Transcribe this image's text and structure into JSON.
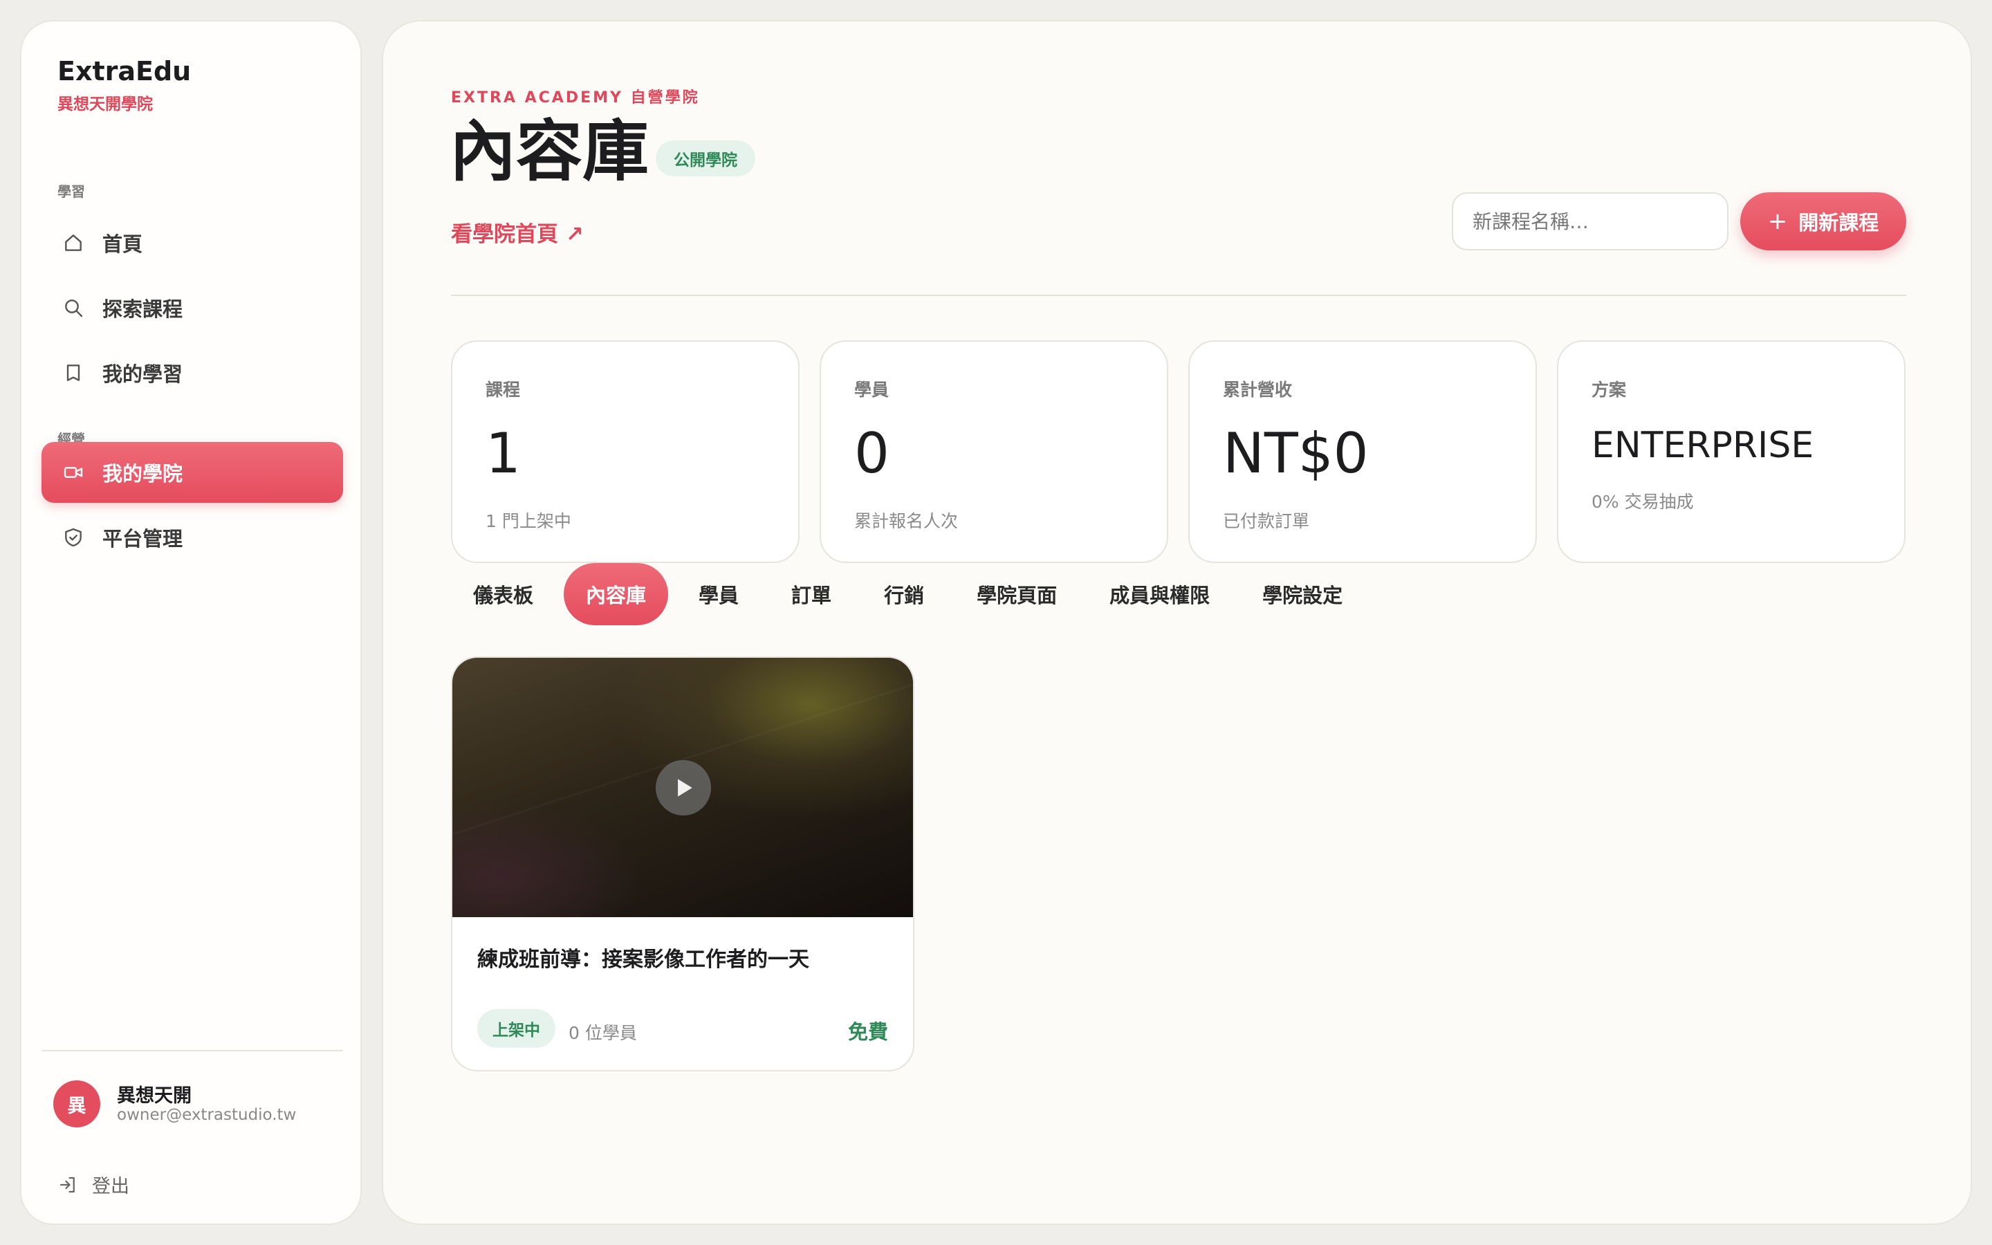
{
  "brand": {
    "name": "ExtraEdu",
    "subtitle": "異想天開學院"
  },
  "sidebar": {
    "sections": [
      {
        "label": "學習"
      },
      {
        "label": "經營"
      }
    ],
    "items": [
      {
        "label": "首頁",
        "icon": "home-icon"
      },
      {
        "label": "探索課程",
        "icon": "search-icon"
      },
      {
        "label": "我的學習",
        "icon": "bookmark-icon"
      },
      {
        "label": "我的學院",
        "icon": "video-icon",
        "active": true
      },
      {
        "label": "平台管理",
        "icon": "shield-icon"
      }
    ],
    "user": {
      "avatar_initial": "異",
      "name": "異想天開",
      "email": "owner@extrastudio.tw"
    },
    "logout_label": "登出"
  },
  "header": {
    "eyebrow": "EXTRA ACADEMY 自營學院",
    "title": "內容庫",
    "badge": "公開學院",
    "view_link": "看學院首頁 ↗",
    "new_course_placeholder": "新課程名稱…",
    "new_course_button": "開新課程"
  },
  "stats": [
    {
      "label": "課程",
      "value": "1",
      "sub": "1 門上架中"
    },
    {
      "label": "學員",
      "value": "0",
      "sub": "累計報名人次"
    },
    {
      "label": "累計營收",
      "value": "NT$0",
      "sub": "已付款訂單"
    },
    {
      "label": "方案",
      "value": "ENTERPRISE",
      "sub": "0% 交易抽成"
    }
  ],
  "tabs": [
    {
      "label": "儀表板"
    },
    {
      "label": "內容庫",
      "active": true
    },
    {
      "label": "學員"
    },
    {
      "label": "訂單"
    },
    {
      "label": "行銷"
    },
    {
      "label": "學院頁面"
    },
    {
      "label": "成員與權限"
    },
    {
      "label": "學院設定"
    }
  ],
  "courses": [
    {
      "title": "練成班前導：接案影像工作者的一天",
      "status": "上架中",
      "students": "0 位學員",
      "price": "免費"
    }
  ],
  "colors": {
    "accent": "#e44d5e",
    "success": "#2e8a57",
    "success_bg": "#e6f3ec"
  }
}
